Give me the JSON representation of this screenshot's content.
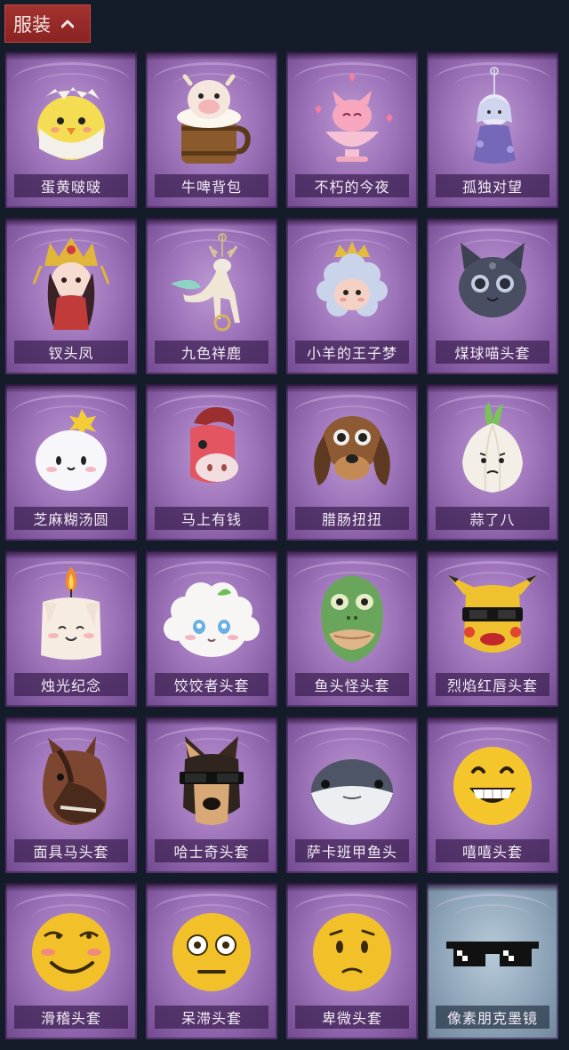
{
  "header": {
    "tab_label": "服装",
    "tab_icon": "chevron-up-icon",
    "accent": "#9a2a28"
  },
  "items": [
    {
      "label": "蛋黄啵啵",
      "icon": "yellow-chick-egg-icon"
    },
    {
      "label": "牛啤背包",
      "icon": "cow-beer-barrel-icon"
    },
    {
      "label": "不朽的今夜",
      "icon": "pink-fox-cup-icon"
    },
    {
      "label": "孤独对望",
      "icon": "doll-pendant-icon"
    },
    {
      "label": "钗头凤",
      "icon": "crowned-princess-icon"
    },
    {
      "label": "九色祥鹿",
      "icon": "deer-charm-icon"
    },
    {
      "label": "小羊的王子梦",
      "icon": "sheep-crown-icon"
    },
    {
      "label": "煤球喵头套",
      "icon": "black-cat-head-icon"
    },
    {
      "label": "芝麻糊汤圆",
      "icon": "rice-ball-head-icon"
    },
    {
      "label": "马上有钱",
      "icon": "red-horse-head-icon"
    },
    {
      "label": "腊肠扭扭",
      "icon": "dachshund-head-icon"
    },
    {
      "label": "蒜了八",
      "icon": "garlic-head-icon"
    },
    {
      "label": "烛光纪念",
      "icon": "candle-head-icon"
    },
    {
      "label": "饺饺者头套",
      "icon": "dumpling-head-icon"
    },
    {
      "label": "鱼头怪头套",
      "icon": "fish-head-icon"
    },
    {
      "label": "烈焰红唇头套",
      "icon": "sunglasses-mask-icon"
    },
    {
      "label": "面具马头套",
      "icon": "horse-mask-icon"
    },
    {
      "label": "哈士奇头套",
      "icon": "husky-head-icon"
    },
    {
      "label": "萨卡班甲鱼头",
      "icon": "sacabambaspis-head-icon"
    },
    {
      "label": "嘻嘻头套",
      "icon": "grin-emoji-head-icon"
    },
    {
      "label": "滑稽头套",
      "icon": "funny-emoji-head-icon"
    },
    {
      "label": "呆滞头套",
      "icon": "dazed-emoji-head-icon"
    },
    {
      "label": "卑微头套",
      "icon": "humble-emoji-head-icon"
    },
    {
      "label": "像素朋克墨镜",
      "icon": "pixel-sunglasses-icon"
    }
  ]
}
